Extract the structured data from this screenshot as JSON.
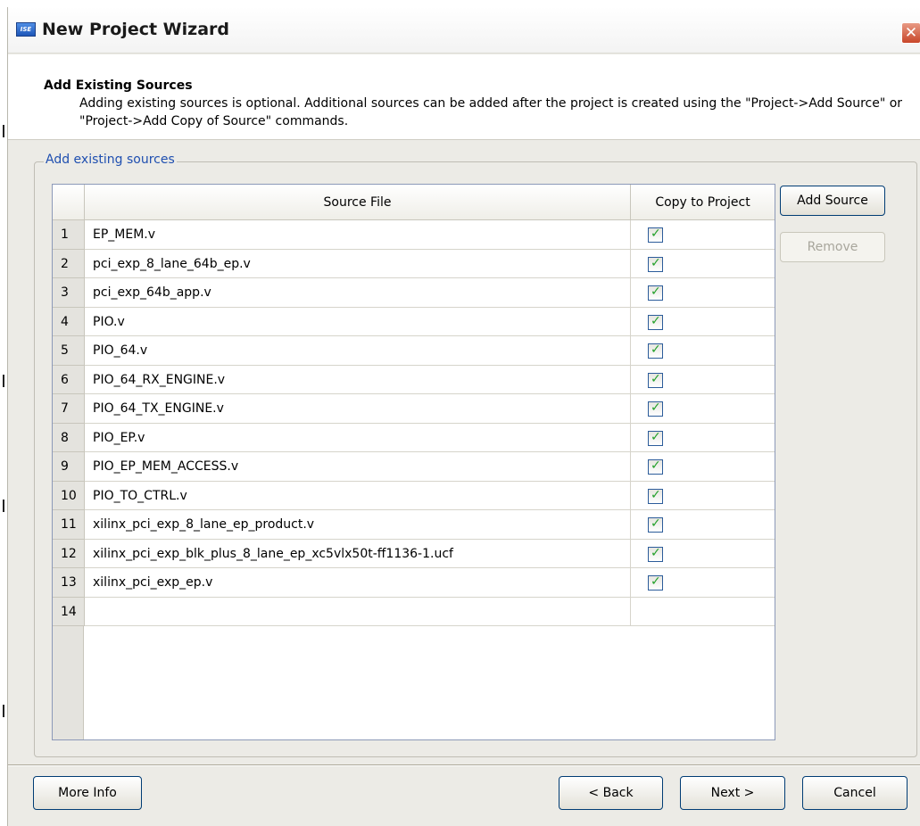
{
  "window": {
    "title": "New Project Wizard",
    "icon_label": "ISE",
    "close_glyph": "✕"
  },
  "header": {
    "title": "Add Existing Sources",
    "description": "Adding existing sources is optional. Additional sources can be added after the project is created using the \"Project->Add Source\" or \"Project->Add Copy of Source\" commands."
  },
  "group": {
    "label": "Add existing sources"
  },
  "grid": {
    "columns": [
      "",
      "Source File",
      "Copy to Project"
    ],
    "rows": [
      {
        "num": "1",
        "file": "EP_MEM.v",
        "copy": true
      },
      {
        "num": "2",
        "file": "pci_exp_8_lane_64b_ep.v",
        "copy": true
      },
      {
        "num": "3",
        "file": "pci_exp_64b_app.v",
        "copy": true
      },
      {
        "num": "4",
        "file": "PIO.v",
        "copy": true
      },
      {
        "num": "5",
        "file": "PIO_64.v",
        "copy": true
      },
      {
        "num": "6",
        "file": "PIO_64_RX_ENGINE.v",
        "copy": true
      },
      {
        "num": "7",
        "file": "PIO_64_TX_ENGINE.v",
        "copy": true
      },
      {
        "num": "8",
        "file": "PIO_EP.v",
        "copy": true
      },
      {
        "num": "9",
        "file": "PIO_EP_MEM_ACCESS.v",
        "copy": true
      },
      {
        "num": "10",
        "file": "PIO_TO_CTRL.v",
        "copy": true
      },
      {
        "num": "11",
        "file": "xilinx_pci_exp_8_lane_ep_product.v",
        "copy": true
      },
      {
        "num": "12",
        "file": "xilinx_pci_exp_blk_plus_8_lane_ep_xc5vlx50t-ff1136-1.ucf",
        "copy": true
      },
      {
        "num": "13",
        "file": "xilinx_pci_exp_ep.v",
        "copy": true
      },
      {
        "num": "14",
        "file": "",
        "copy": false
      }
    ],
    "check_glyph": "✓"
  },
  "side_buttons": {
    "add_source": "Add Source",
    "remove": "Remove"
  },
  "footer": {
    "more_info": "More Info",
    "back": "< Back",
    "next": "Next >",
    "cancel": "Cancel"
  }
}
